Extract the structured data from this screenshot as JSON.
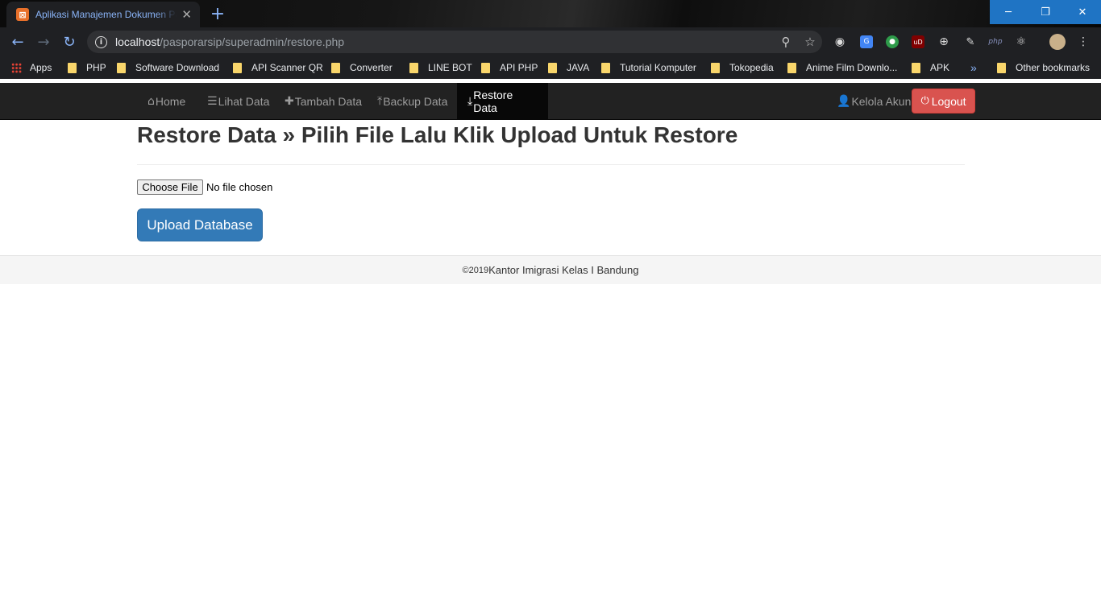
{
  "browser": {
    "tab_title": "Aplikasi Manajemen Dokumen Pa",
    "favicon_glyph": "⊠",
    "url_host": "localhost",
    "url_path": "/pasporarsip/superadmin/restore.php",
    "window_controls": {
      "minimize": "─",
      "restore": "❐",
      "close": "✕"
    },
    "bookmarks": [
      "PHP",
      "Software Download",
      "API Scanner QR",
      "Converter",
      "LINE BOT",
      "API PHP",
      "JAVA",
      "Tutorial Komputer",
      "Tokopedia",
      "Anime Film Downlo...",
      "APK"
    ],
    "apps_label": "Apps",
    "overflow_label": "»",
    "other_bookmarks_label": "Other bookmarks",
    "extension_php_label": "php",
    "extension_ud_label": "uD"
  },
  "navbar": {
    "items": [
      {
        "icon": "home-icon",
        "glyph": "⌂",
        "label": "Home"
      },
      {
        "icon": "list-icon",
        "glyph": "☰",
        "label": "Lihat Data"
      },
      {
        "icon": "plus-icon",
        "glyph": "✚",
        "label": "Tambah Data"
      },
      {
        "icon": "export-icon",
        "glyph": "⤒",
        "label": "Backup Data"
      },
      {
        "icon": "import-icon",
        "glyph": "⤓",
        "label": "Restore Data",
        "active": true
      }
    ],
    "account": {
      "icon": "user-icon",
      "glyph": "👤",
      "label": "Kelola Akun"
    },
    "logout": {
      "icon": "power-icon",
      "glyph": "⏻",
      "label": "Logout"
    }
  },
  "main": {
    "title": "Restore Data » Pilih File Lalu Klik Upload Untuk Restore",
    "file_button_label": "Choose File",
    "file_status": "No file chosen",
    "upload_button_label": "Upload Database"
  },
  "footer": {
    "copyright": "©2019",
    "text": " Kantor Imigrasi Kelas I Bandung"
  },
  "colors": {
    "navbar_bg": "#222222",
    "active_nav_bg": "#080808",
    "logout_bg": "#d9534f",
    "upload_bg": "#337ab7",
    "footer_bg": "#f5f5f5"
  }
}
